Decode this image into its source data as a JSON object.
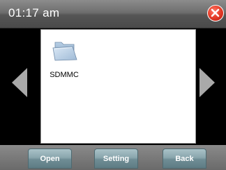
{
  "status_bar": {
    "time": "01:17 am",
    "close_icon": "close-icon"
  },
  "navigation": {
    "prev_icon": "arrow-left-icon",
    "next_icon": "arrow-right-icon"
  },
  "file_browser": {
    "items": [
      {
        "label": "SDMMC",
        "icon": "folder-icon"
      }
    ]
  },
  "toolbar": {
    "open_label": "Open",
    "setting_label": "Setting",
    "back_label": "Back"
  },
  "colors": {
    "close_button": "#e8402c",
    "button_face": "#8aa6ad",
    "titlebar": "#6e6e6e"
  }
}
